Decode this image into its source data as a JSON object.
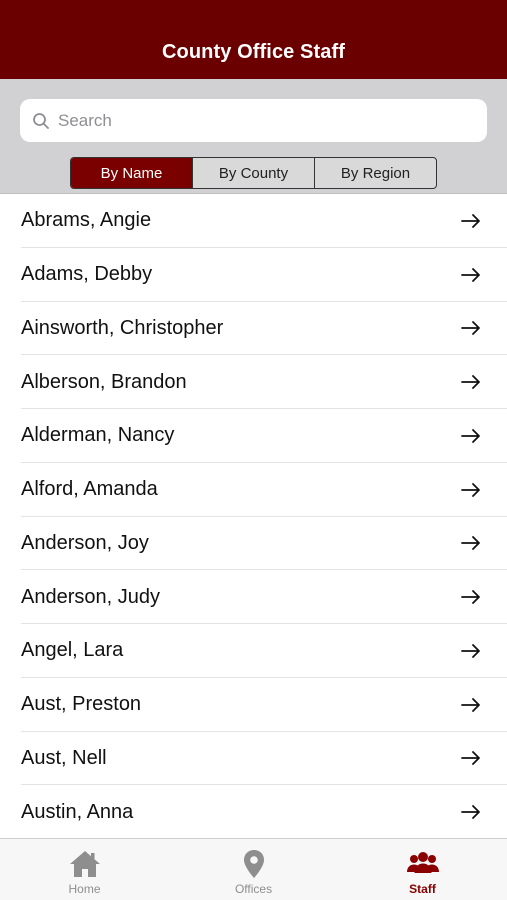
{
  "header": {
    "title": "County Office Staff"
  },
  "search": {
    "placeholder": "Search",
    "value": "",
    "icon": "search-icon"
  },
  "segments": [
    {
      "label": "By Name",
      "active": true
    },
    {
      "label": "By County",
      "active": false
    },
    {
      "label": "By Region",
      "active": false
    }
  ],
  "staff": [
    {
      "name": "Abrams, Angie"
    },
    {
      "name": "Adams, Debby"
    },
    {
      "name": "Ainsworth, Christopher"
    },
    {
      "name": "Alberson, Brandon"
    },
    {
      "name": "Alderman, Nancy"
    },
    {
      "name": "Alford, Amanda"
    },
    {
      "name": "Anderson, Joy"
    },
    {
      "name": "Anderson, Judy"
    },
    {
      "name": "Angel, Lara"
    },
    {
      "name": "Aust, Preston"
    },
    {
      "name": "Aust, Nell"
    },
    {
      "name": "Austin, Anna"
    }
  ],
  "tabbar": {
    "items": [
      {
        "label": "Home",
        "icon": "home-icon",
        "active": false
      },
      {
        "label": "Offices",
        "icon": "map-pin-icon",
        "active": false
      },
      {
        "label": "Staff",
        "icon": "people-icon",
        "active": true
      }
    ]
  },
  "colors": {
    "brand": "#6b0000",
    "segment_active": "#7a0000",
    "tab_active": "#8b0000",
    "tab_inactive": "#8e8e8e"
  }
}
